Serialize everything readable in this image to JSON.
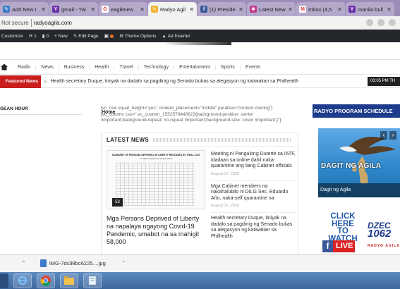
{
  "browser": {
    "tabs": [
      {
        "label": "Add New I",
        "fav_color": "#3d7cc9",
        "fav_glyph": "✎",
        "icon": "pencil-icon",
        "active": false
      },
      {
        "label": "gmail - Yal",
        "fav_color": "#6b2fa8",
        "fav_glyph": "Y",
        "icon": "yahoo-icon",
        "active": false
      },
      {
        "label": "eaglenew",
        "fav_color": "#ffffff",
        "fav_glyph": "G",
        "icon": "google-icon",
        "active": false
      },
      {
        "label": "Radyo Agil",
        "fav_color": "#f2b233",
        "fav_glyph": "✎",
        "icon": "pencil-icon",
        "active": true
      },
      {
        "label": "(1) Preside",
        "fav_color": "#3b5998",
        "fav_glyph": "f",
        "icon": "facebook-icon",
        "active": false
      },
      {
        "label": "Latest New",
        "fav_color": "#c23a8c",
        "fav_glyph": "✱",
        "icon": "news-icon",
        "active": false
      },
      {
        "label": "Inbox (4,5",
        "fav_color": "#ffffff",
        "fav_glyph": "M",
        "icon": "gmail-icon",
        "active": false
      },
      {
        "label": "manila bull",
        "fav_color": "#6b2fa8",
        "fav_glyph": "Y",
        "icon": "yahoo-icon",
        "active": false
      }
    ],
    "security_label": "Not secure",
    "url": "radyoagila.com"
  },
  "adminbar": {
    "customize": "Customize",
    "updates_count": "1",
    "comments_count": "0",
    "new_label": "New",
    "edit_page": "Edit Page",
    "theme_options": "Theme Options",
    "ad_inserter": "Ad Inserter"
  },
  "nav": {
    "items": [
      "Radio",
      "News",
      "Business",
      "Health",
      "Travel",
      "Technology",
      "Entertainment",
      "Sports",
      "Events"
    ]
  },
  "ticker": {
    "label": "Featured News",
    "text": "Health secretary Duque, tiniyak na dadalo sa pagdinig ng Senado bukas sa alegasyon ng katiwalian sa Philhealth",
    "time": "03:05 PM TH"
  },
  "left": {
    "heading": "GEAN HOUR"
  },
  "center": {
    "home_label": "Home",
    "shortcode": "[vc_row equal_height=\"yes\" content_placement=\"middle\" parallax=\"content-moving\"][vc_column css=\".vc_custom_1552578443623{background-position: center !important;background-repeat: no-repeat !important;background-size: cover !important;}\"]",
    "latest_title": "LATEST NEWS",
    "feature_image_title": "SUMMARY OF PERSONS DEPRIVED OF LIBERTY RELEASED BY TRIAL COU",
    "feature_image_sub": "17 March 2020 to 14 August 2020",
    "feature_badge": "53",
    "feature_headline": "Mga Persons Deprived of Liberty na napalaya ngayong Covid-19 Pandemic, umabot na sa mahigit 58,000",
    "list": [
      {
        "title": "Meeting ni Pangulong Duterte sa IATF, idadaan sa online dahil naka-quarantine ang ilang Cabinet officials",
        "date": "August 17, 2020"
      },
      {
        "title": "Mga Cabinet members na nakahalubilo ni DILG Sec. Eduardo Año, naka-self quarantine na",
        "date": "August 17, 2020"
      },
      {
        "title": "Health secretary Duque, tiniyak na dadalo sa pagdinig ng Senado bukas sa alegasyon ng katiwalian sa Philhealth",
        "date": ""
      }
    ]
  },
  "right": {
    "schedule_banner": "RADYO PROGRAM SCHEDULE",
    "dagit_text": "DAGIT NG AGILA",
    "dagit_caption": "Dagit ng Agila",
    "click_text": "CLICK HERE TO WATCH",
    "live_label": "LIVE",
    "dzec": "DZEC",
    "freq": "1062",
    "radyo_tag": "RADYO AGILA"
  },
  "downloads": {
    "file_name": "IMG-7dc98bc6225....jpg"
  },
  "taskbar": {
    "apps": [
      "ie-icon",
      "chrome-icon",
      "explorer-icon",
      "notes-icon"
    ]
  }
}
